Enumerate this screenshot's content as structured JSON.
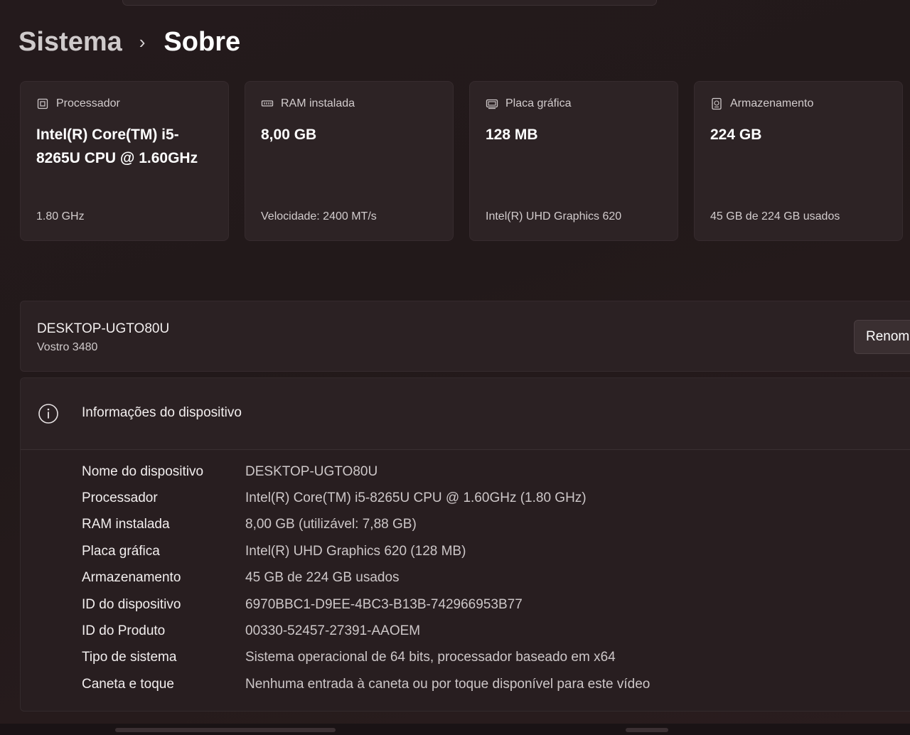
{
  "breadcrumb": {
    "parent": "Sistema",
    "separator": "›",
    "current": "Sobre"
  },
  "cards": [
    {
      "icon": "processor-icon",
      "label": "Processador",
      "value": "Intel(R) Core(TM) i5-8265U CPU @ 1.60GHz",
      "sub": "1.80 GHz"
    },
    {
      "icon": "ram-icon",
      "label": "RAM instalada",
      "value": "8,00 GB",
      "sub": "Velocidade: 2400 MT/s"
    },
    {
      "icon": "graphics-card-icon",
      "label": "Placa gráfica",
      "value": "128 MB",
      "sub": "Intel(R) UHD Graphics 620"
    },
    {
      "icon": "storage-icon",
      "label": "Armazenamento",
      "value": "224 GB",
      "sub": "45 GB de 224 GB usados"
    }
  ],
  "device": {
    "name": "DESKTOP-UGTO80U",
    "model": "Vostro 3480",
    "rename_label": "Renomear este PC"
  },
  "info": {
    "title": "Informações do dispositivo",
    "rows": [
      {
        "key": "Nome do dispositivo",
        "value": "DESKTOP-UGTO80U"
      },
      {
        "key": "Processador",
        "value": "Intel(R) Core(TM) i5-8265U CPU @ 1.60GHz (1.80 GHz)"
      },
      {
        "key": "RAM instalada",
        "value": "8,00 GB (utilizável: 7,88 GB)"
      },
      {
        "key": "Placa gráfica",
        "value": "Intel(R) UHD Graphics 620 (128 MB)"
      },
      {
        "key": "Armazenamento",
        "value": "45 GB de 224 GB usados"
      },
      {
        "key": "ID do dispositivo",
        "value": "6970BBC1-D9EE-4BC3-B13B-742966953B77"
      },
      {
        "key": "ID do Produto",
        "value": "00330-52457-27391-AAOEM"
      },
      {
        "key": "Tipo de sistema",
        "value": "Sistema operacional de 64 bits, processador baseado em x64"
      },
      {
        "key": "Caneta e toque",
        "value": "Nenhuma entrada à caneta ou por toque disponível para este vídeo"
      }
    ]
  }
}
